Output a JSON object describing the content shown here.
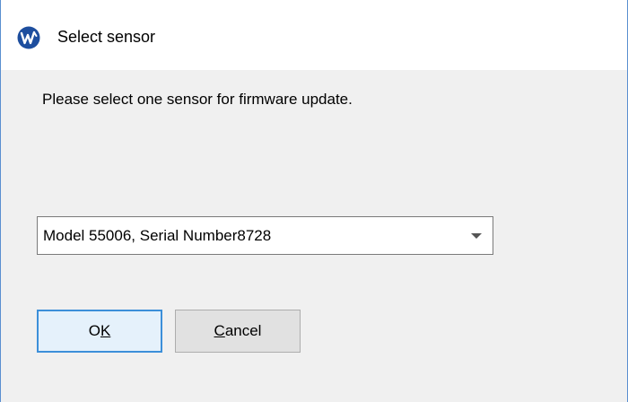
{
  "window": {
    "title": "Select sensor",
    "icon": "app-logo-icon"
  },
  "prompt": "Please select one sensor for firmware update.",
  "sensor_select": {
    "selected_value": "Model 55006, Serial Number8728",
    "icon": "chevron-down-icon"
  },
  "buttons": {
    "ok": {
      "label": "OK",
      "mnemonic": "K"
    },
    "cancel": {
      "label": "Cancel",
      "mnemonic": "C"
    }
  },
  "colors": {
    "accent": "#3c8fd9",
    "window_border": "#5a8fd0",
    "background": "#f0f0f0",
    "icon_blue": "#1d4e9e"
  }
}
